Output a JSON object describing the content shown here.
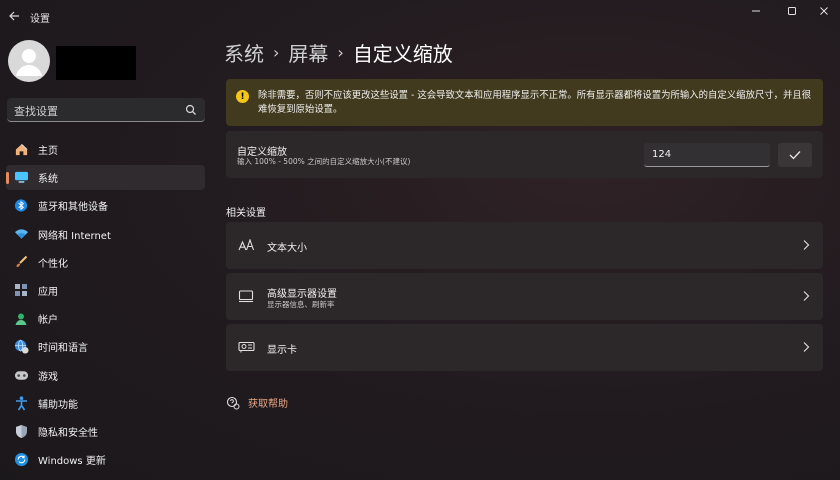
{
  "window": {
    "title": "设置"
  },
  "search": {
    "placeholder": "查找设置"
  },
  "sidebar": {
    "items": [
      {
        "label": "主页",
        "icon": "home-icon"
      },
      {
        "label": "系统",
        "icon": "system-display-icon"
      },
      {
        "label": "蓝牙和其他设备",
        "icon": "bluetooth-icon"
      },
      {
        "label": "网络和 Internet",
        "icon": "wifi-icon"
      },
      {
        "label": "个性化",
        "icon": "brush-icon"
      },
      {
        "label": "应用",
        "icon": "apps-icon"
      },
      {
        "label": "帐户",
        "icon": "account-icon"
      },
      {
        "label": "时间和语言",
        "icon": "globe-clock-icon"
      },
      {
        "label": "游戏",
        "icon": "gamepad-icon"
      },
      {
        "label": "辅助功能",
        "icon": "accessibility-icon"
      },
      {
        "label": "隐私和安全性",
        "icon": "shield-icon"
      },
      {
        "label": "Windows 更新",
        "icon": "update-icon"
      }
    ],
    "active_index": 1
  },
  "breadcrumb": {
    "items": [
      "系统",
      "屏幕",
      "自定义缩放"
    ],
    "separator": "›"
  },
  "warning": {
    "text": "除非需要，否则不应该更改这些设置 - 这会导致文本和应用程序显示不正常。所有显示器都将设置为所输入的自定义缩放尺寸，并且很难恢复到原始设置。",
    "icon_glyph": "!"
  },
  "custom_scale": {
    "title": "自定义缩放",
    "description": "输入 100% - 500% 之间的自定义缩放大小(不建议)",
    "value": "124"
  },
  "related": {
    "title": "相关设置",
    "items": [
      {
        "label": "文本大小",
        "sub": "",
        "icon": "text-size-icon"
      },
      {
        "label": "高级显示器设置",
        "sub": "显示器信息、刷新率",
        "icon": "monitor-icon"
      },
      {
        "label": "显示卡",
        "sub": "",
        "icon": "graphics-card-icon"
      }
    ]
  },
  "help": {
    "label": "获取帮助"
  },
  "colors": {
    "accent": "#e48a5e",
    "warning_bg": "#423a1e",
    "warning_icon": "#f5c518"
  }
}
